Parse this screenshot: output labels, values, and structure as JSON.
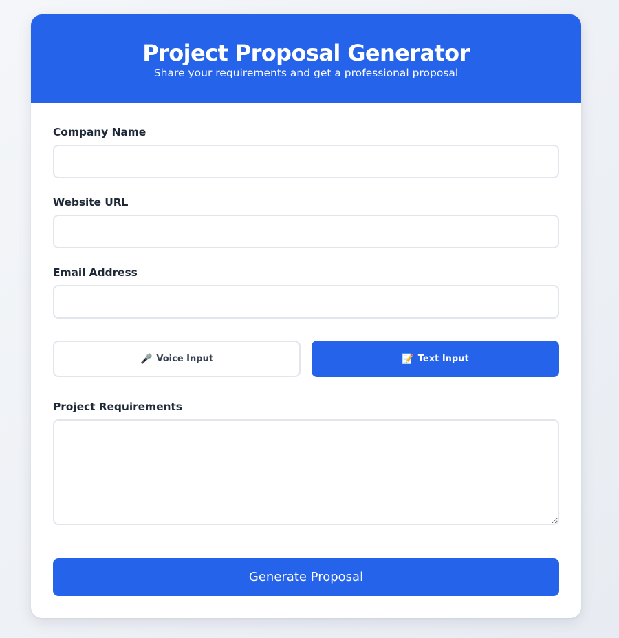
{
  "header": {
    "title": "Project Proposal Generator",
    "subtitle": "Share your requirements and get a professional proposal"
  },
  "form": {
    "company": {
      "label": "Company Name",
      "value": "",
      "placeholder": ""
    },
    "website": {
      "label": "Website URL",
      "value": "",
      "placeholder": ""
    },
    "email": {
      "label": "Email Address",
      "value": "",
      "placeholder": ""
    },
    "input_mode": {
      "voice": {
        "label": "Voice Input",
        "icon": "microphone-icon",
        "glyph": "🎤",
        "selected": false
      },
      "text": {
        "label": "Text Input",
        "icon": "memo-icon",
        "glyph": "📝",
        "selected": true
      }
    },
    "requirements": {
      "label": "Project Requirements",
      "value": "",
      "placeholder": ""
    },
    "submit_label": "Generate Proposal"
  },
  "colors": {
    "accent": "#2563eb",
    "border": "#e2e6ec",
    "text": "#1f2937"
  }
}
